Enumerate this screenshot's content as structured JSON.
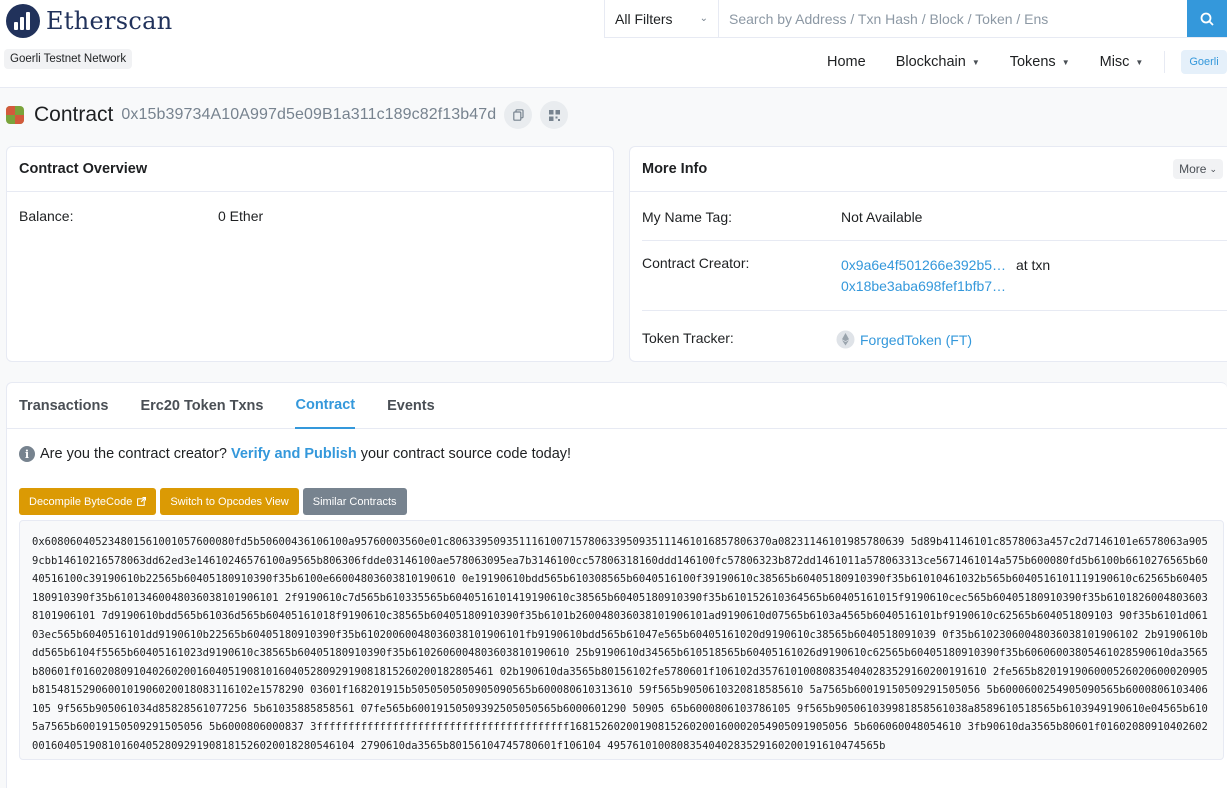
{
  "header": {
    "brand": "Etherscan",
    "network": "Goerli Testnet Network",
    "search": {
      "filter": "All Filters",
      "placeholder": "Search by Address / Txn Hash / Block / Token / Ens"
    },
    "nav": [
      {
        "label": "Home"
      },
      {
        "label": "Blockchain"
      },
      {
        "label": "Tokens"
      },
      {
        "label": "Misc"
      }
    ],
    "network_pill": "Goerli"
  },
  "title": {
    "label": "Contract",
    "address": "0x15b39734A10A997d5e09B1a311c189c82f13b47d"
  },
  "overview": {
    "header": "Contract Overview",
    "balance_label": "Balance:",
    "balance_value": "0 Ether"
  },
  "more_info": {
    "header": "More Info",
    "more_button": "More",
    "name_tag_label": "My Name Tag:",
    "name_tag_value": "Not Available",
    "creator_label": "Contract Creator:",
    "creator_address": "0x9a6e4f501266e392b5…",
    "creator_at": "at txn",
    "creator_txn": "0x18be3aba698fef1bfb7…",
    "token_label": "Token Tracker:",
    "token_value": "ForgedToken (FT)"
  },
  "tabs": [
    {
      "label": "Transactions"
    },
    {
      "label": "Erc20 Token Txns"
    },
    {
      "label": "Contract"
    },
    {
      "label": "Events"
    }
  ],
  "verify": {
    "prefix": "Are you the contract creator?",
    "link": "Verify and Publish",
    "suffix": "your contract source code today!"
  },
  "buttons": {
    "decompile": "Decompile ByteCode",
    "opcodes": "Switch to Opcodes View",
    "similar": "Similar Contracts"
  },
  "bytecode": "0x608060405234801561001057600080fd5b50600436106100a95760003560e01c806339509351116100715780633950935111461016857806370a08231146101985780639 5d89b41146101c8578063a457c2d7146101e6578063a9059cbb14610216578063dd62ed3e14610246576100a9565b806306fdde03146100ae578063095ea7b3146100cc57806318160ddd146100fc57806323b872dd1461011a578063313ce5671461014a575b600080fd5b6100b6610276565b6040516100c39190610b22565b60405180910390f35b6100e66004803603810190610 0e19190610bdd565b610308565b6040516100f39190610c38565b60405180910390f35b61010461032b565b6040516101119190610c62565b60405180910390f35b61013460048036038101906101 2f9190610c7d565b610335565b6040516101419190610c38565b60405180910390f35b610152610364565b60405161015f9190610cec565b60405180910390f35b61018260048036038101906101 7d9190610bdd565b61036d565b60405161018f9190610c38565b60405180910390f35b6101b260048036038101906101ad9190610d07565b6103a4565b6040516101bf9190610c62565b604051809103 90f35b6101d06103ec565b6040516101dd9190610b22565b60405180910390f35b61020060048036038101906101fb9190610bdd565b61047e565b60405161020d9190610c38565b6040518091039 0f35b61023060048036038101906102 2b9190610bdd565b6104f5565b60405161023d9190610c38565b60405180910390f35b6102606004803603810190610 25b9190610d34565b610518565b60405161026d9190610c62565b60405180910390f35b60606003805461028590610da3565b80601f016020809104026020016040519081016040528092919081815260200182805461 02b190610da3565b80156102fe5780601f106102d357610100808354040283529160200191610 2fe565b820191906000526020600020905b8154815290600101906020018083116102e1578290 03601f168201915b5050505050905090565b600080610313610 59f565b9050610320818585610 5a7565b60019150509291505056 5b6000600254905090565b6000806103406105 9f565b905061034d85828561077256 5b61035885858561 07fe565b60019150509392505050565b6000601290 50905 65b6000806103786105 9f565b905061039981858561038a8589610518565b6103949190610e04565b6105a7565b60019150509291505056 5b6000806000837 3ffffffffffffffffffffffffffffffffffffffff16815260200190815260200160002054905091905056 5b606060048054610 3fb90610da3565b80601f01602080910402602001604051908101604052809291908181526020018280546104 2790610da3565b80156104745780601f106104 4957610100808354040283529160200191610474565b"
}
